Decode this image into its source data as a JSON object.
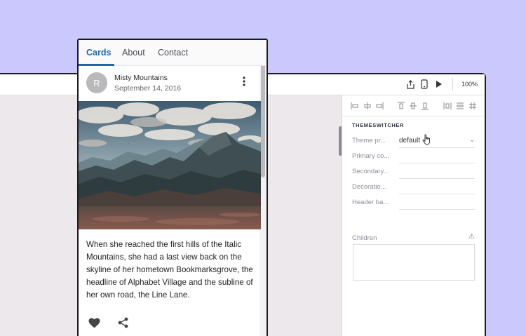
{
  "editor": {
    "zoom": "100%",
    "toolbar_icons": [
      "export-icon",
      "device-icon",
      "play-icon"
    ],
    "align_icons": [
      "align-left-icon",
      "align-center-h-icon",
      "align-right-icon",
      "align-top-icon",
      "align-middle-icon",
      "align-bottom-icon",
      "distribute-h-icon",
      "distribute-v-icon",
      "grid-icon"
    ],
    "panel": {
      "title": "THEMESWITCHER",
      "props": [
        {
          "label": "Theme pr...",
          "value": "default",
          "has_dropdown": true
        },
        {
          "label": "Primary co...",
          "value": ""
        },
        {
          "label": "Secondary...",
          "value": ""
        },
        {
          "label": "Decoratio...",
          "value": ""
        },
        {
          "label": "Header ba...",
          "value": ""
        }
      ],
      "children_label": "Children",
      "warning_icon": "warning-icon"
    }
  },
  "phone": {
    "tabs": [
      {
        "label": "Cards",
        "active": true
      },
      {
        "label": "About",
        "active": false
      },
      {
        "label": "Contact",
        "active": false
      }
    ],
    "card": {
      "avatar_letter": "R",
      "title": "Misty Mountains",
      "date": "September 14, 2016",
      "body": "When she reached the first hills of the Italic Mountains, she had a last view back on the skyline of her hometown Bookmarksgrove, the headline of Alphabet Village and the subline of her own road, the Line Lane.",
      "actions": [
        "heart-icon",
        "share-icon"
      ]
    }
  },
  "colors": {
    "background": "#cbc8fd",
    "accent": "#1f6aa8"
  }
}
